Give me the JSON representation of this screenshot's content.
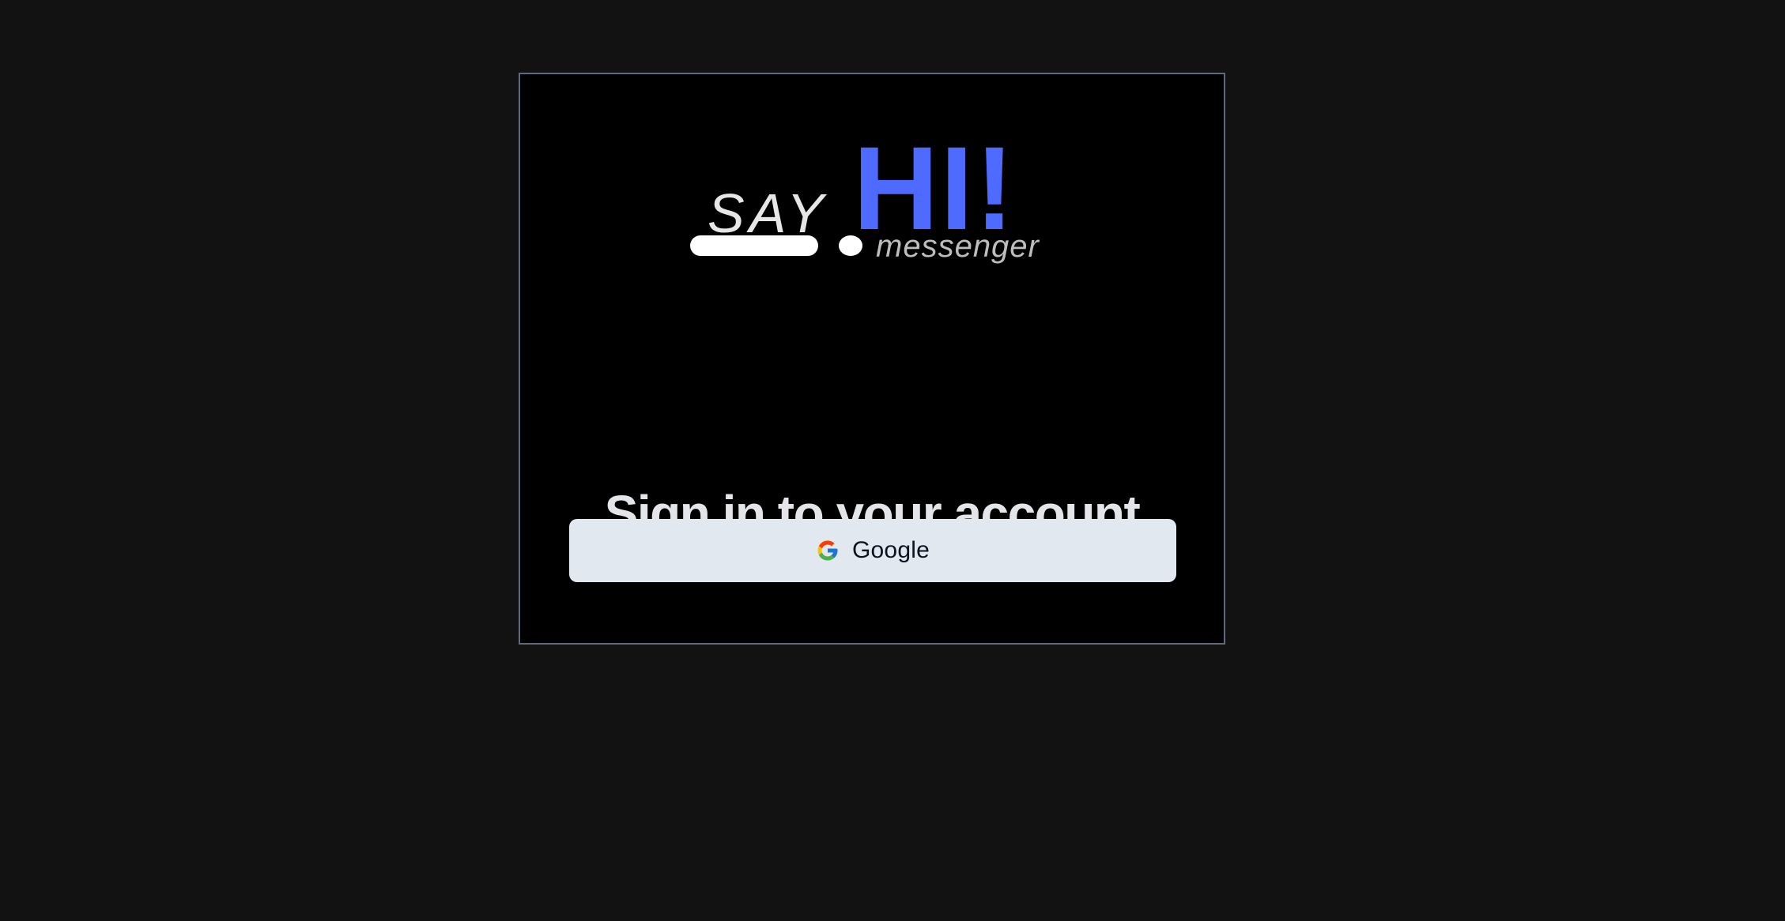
{
  "logo": {
    "say": "SAY",
    "hi": "HI!",
    "sub": "messenger",
    "accent_color": "#4f6bff"
  },
  "auth": {
    "heading": "Sign in to your account",
    "google_label": "Google",
    "google_icon": "google-g-icon"
  }
}
